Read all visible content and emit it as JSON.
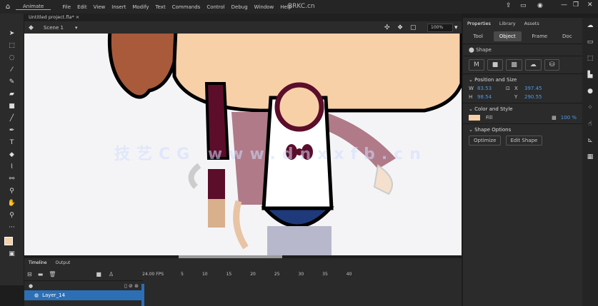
{
  "menubar": {
    "app": "Animate",
    "items": [
      "File",
      "Edit",
      "View",
      "Insert",
      "Modify",
      "Text",
      "Commands",
      "Control",
      "Debug",
      "Window",
      "Help"
    ],
    "logo": "BRKC.cn"
  },
  "document": {
    "tab": "Untitled project.fla* ×",
    "scene": "Scene 1",
    "zoom": "100%"
  },
  "watermark": "技艺CG www.dnxxfb.cn",
  "properties": {
    "tabs": [
      "Properties",
      "Library",
      "Assets"
    ],
    "subtabs": [
      "Tool",
      "Object",
      "Frame",
      "Doc"
    ],
    "active_subtab": "Object",
    "type": "Shape",
    "position_size": {
      "title": "Position and Size",
      "w_label": "W",
      "w": "83.53",
      "h_label": "H",
      "h": "98.54",
      "x_label": "X",
      "x": "397.45",
      "y_label": "Y",
      "y": "290.55"
    },
    "color_style": {
      "title": "Color and Style",
      "fill_label": "Fill",
      "fill_color": "#f7d0a8",
      "alpha": "100 %"
    },
    "shape_options": {
      "title": "Shape Options",
      "buttons": [
        "Optimize",
        "Edit Shape"
      ]
    }
  },
  "timeline": {
    "tabs": [
      "Timeline",
      "Output"
    ],
    "fps": "24.00 FPS",
    "frame_numbers": [
      "5",
      "10",
      "15",
      "20",
      "25",
      "30",
      "35",
      "40"
    ],
    "layer": "Layer_14"
  },
  "colors": {
    "accent": "#2d6fb5",
    "stroke": "#5c0d2a",
    "fill": "#f7d0a8"
  }
}
